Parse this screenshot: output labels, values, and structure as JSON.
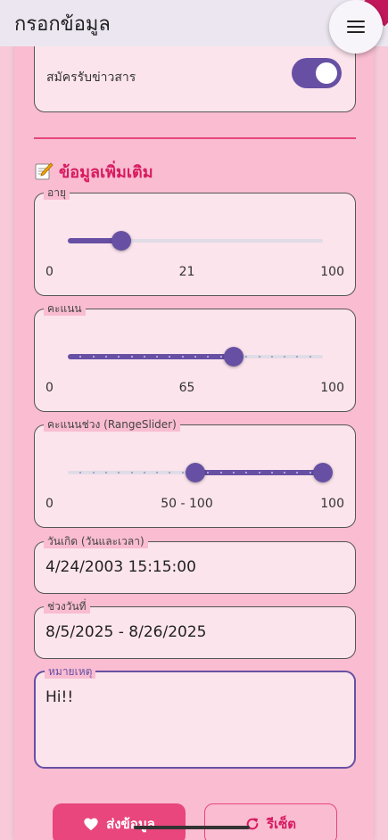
{
  "appbar": {
    "title": "กรอกข้อมูล"
  },
  "newsletter": {
    "label": "สมัครรับข่าวสาร",
    "enabled": true
  },
  "section": {
    "title": "ข้อมูลเพิ่มเติม"
  },
  "age": {
    "legend": "อายุ",
    "min": "0",
    "max": "100",
    "value": "21",
    "fraction": 0.21
  },
  "score": {
    "legend": "คะแนน",
    "min": "0",
    "max": "100",
    "value": "65",
    "fraction": 0.65,
    "divisions": 20
  },
  "score_range": {
    "legend": "คะแนนช่วง (RangeSlider)",
    "min": "0",
    "max": "100",
    "value": "50 - 100",
    "start_fraction": 0.5,
    "end_fraction": 1.0,
    "divisions": 20
  },
  "birthdate": {
    "legend": "วันเกิด (วันและเวลา)",
    "value": "4/24/2003 15:15:00"
  },
  "date_range": {
    "legend": "ช่วงวันที่",
    "value": "8/5/2025 - 8/26/2025"
  },
  "note": {
    "legend": "หมายเหตุ",
    "value": "Hi!!"
  },
  "actions": {
    "submit_label": "ส่งข้อมูล",
    "reset_label": "รีเซ็ต"
  },
  "colors": {
    "primary": "#6750a4",
    "accent": "#e8467c",
    "panel": "#f9bcd1",
    "card": "#fce4ec"
  },
  "icons": {
    "menu": "menu-icon",
    "memo": "memo-icon",
    "heart": "heart-icon",
    "refresh": "refresh-icon"
  }
}
